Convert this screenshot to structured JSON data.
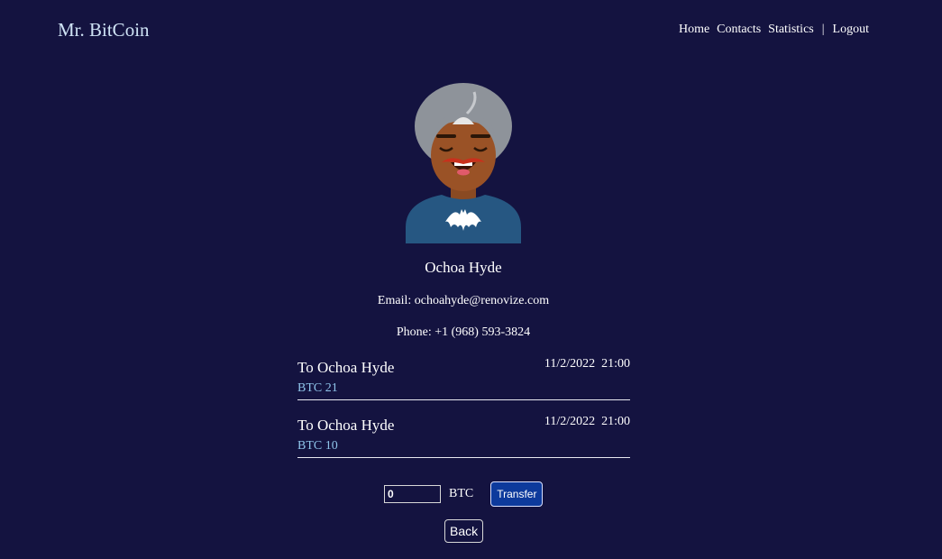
{
  "header": {
    "logo": "Mr. BitCoin",
    "nav": {
      "home": "Home",
      "contacts": "Contacts",
      "statistics": "Statistics",
      "separator": "|",
      "logout": "Logout"
    }
  },
  "contact": {
    "avatar_icon": "avatar-illustration",
    "name": "Ochoa Hyde",
    "email": "Email: ochoahyde@renovize.com",
    "phone": "Phone: +1 (968) 593-3824"
  },
  "moves": [
    {
      "to": "To Ochoa Hyde",
      "date": "11/2/2022  21:00",
      "amount": "BTC 21"
    },
    {
      "to": "To Ochoa Hyde",
      "date": "11/2/2022  21:00",
      "amount": "BTC 10"
    }
  ],
  "transfer": {
    "value": "0",
    "currency": "BTC",
    "button": "Transfer"
  },
  "back": "Back",
  "colors": {
    "background": "#141340",
    "accent_link": "#8fc4ea",
    "button": "#0d3a9c"
  }
}
